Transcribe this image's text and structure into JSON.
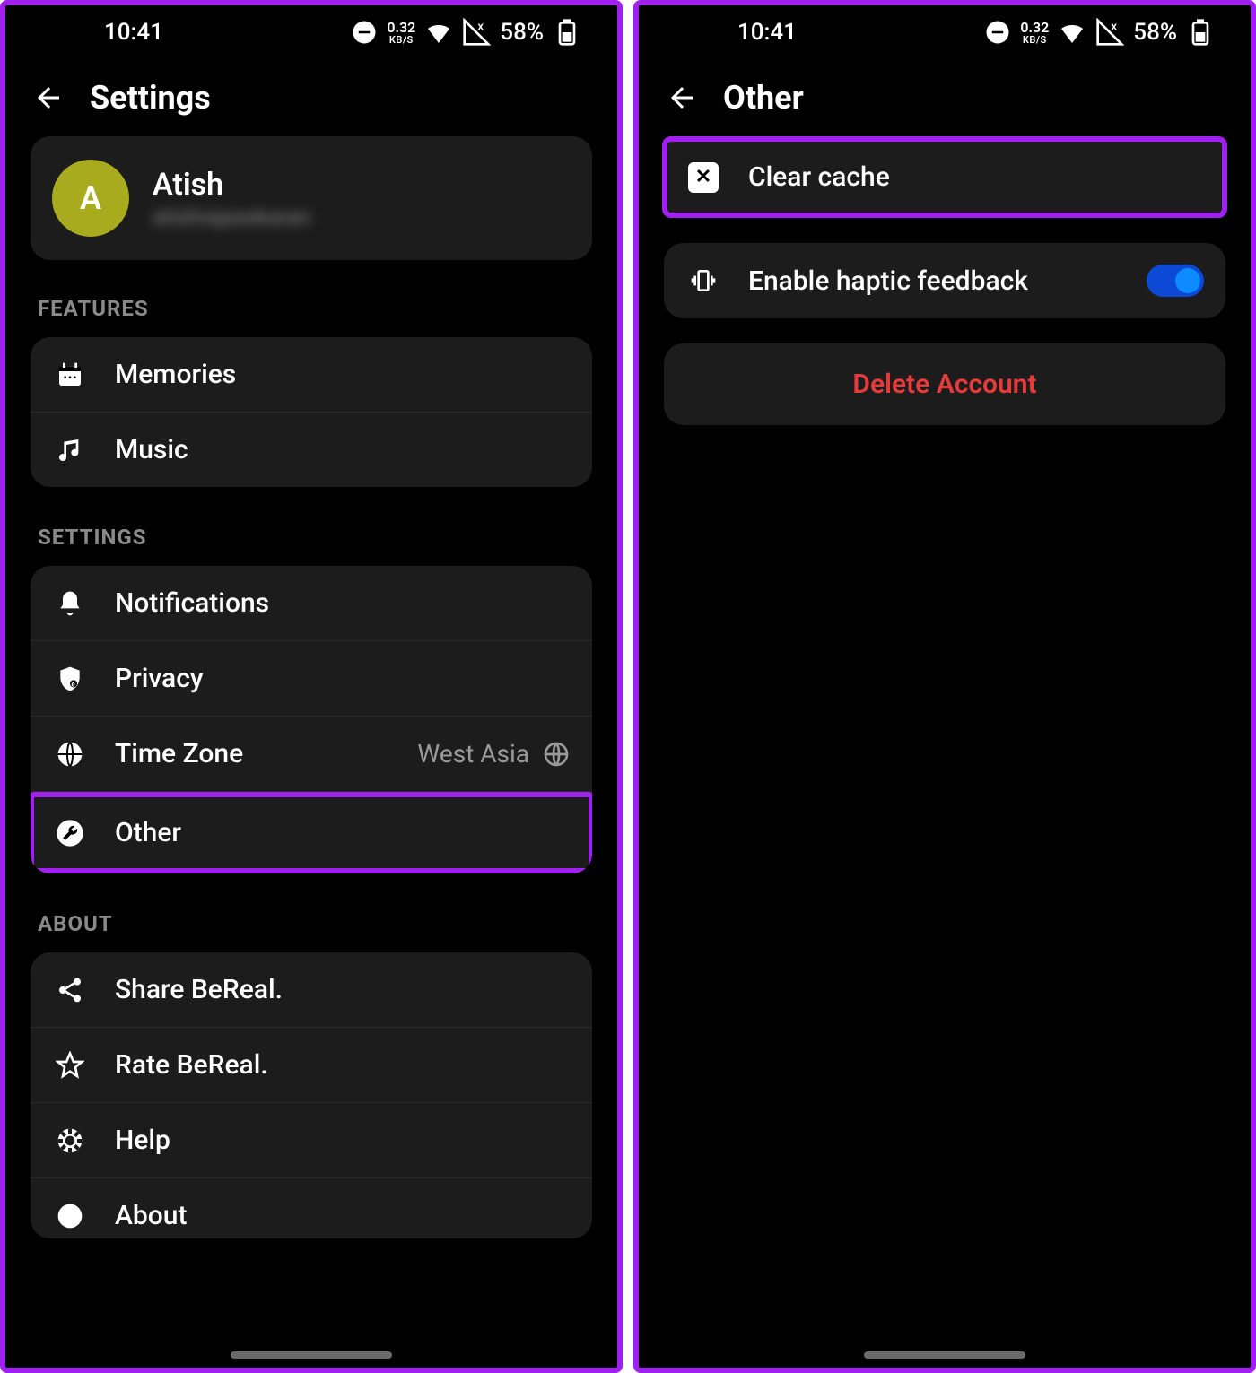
{
  "status": {
    "time": "10:41",
    "speed_top": "0.32",
    "speed_bot": "KB/S",
    "battery_pct": "58%"
  },
  "screen1": {
    "header_title": "Settings",
    "profile": {
      "initial": "A",
      "name": "Atish",
      "subtitle": "atishrajasekaran"
    },
    "sections": {
      "features_label": "FEATURES",
      "settings_label": "SETTINGS",
      "about_label": "ABOUT"
    },
    "features": {
      "memories": "Memories",
      "music": "Music"
    },
    "settings_items": {
      "notifications": "Notifications",
      "privacy": "Privacy",
      "timezone": "Time Zone",
      "timezone_value": "West Asia",
      "other": "Other"
    },
    "about_items": {
      "share": "Share BeReal.",
      "rate": "Rate BeReal.",
      "help": "Help",
      "about": "About"
    }
  },
  "screen2": {
    "header_title": "Other",
    "clear_cache": "Clear cache",
    "haptic": "Enable haptic feedback",
    "haptic_on": true,
    "delete": "Delete Account"
  }
}
